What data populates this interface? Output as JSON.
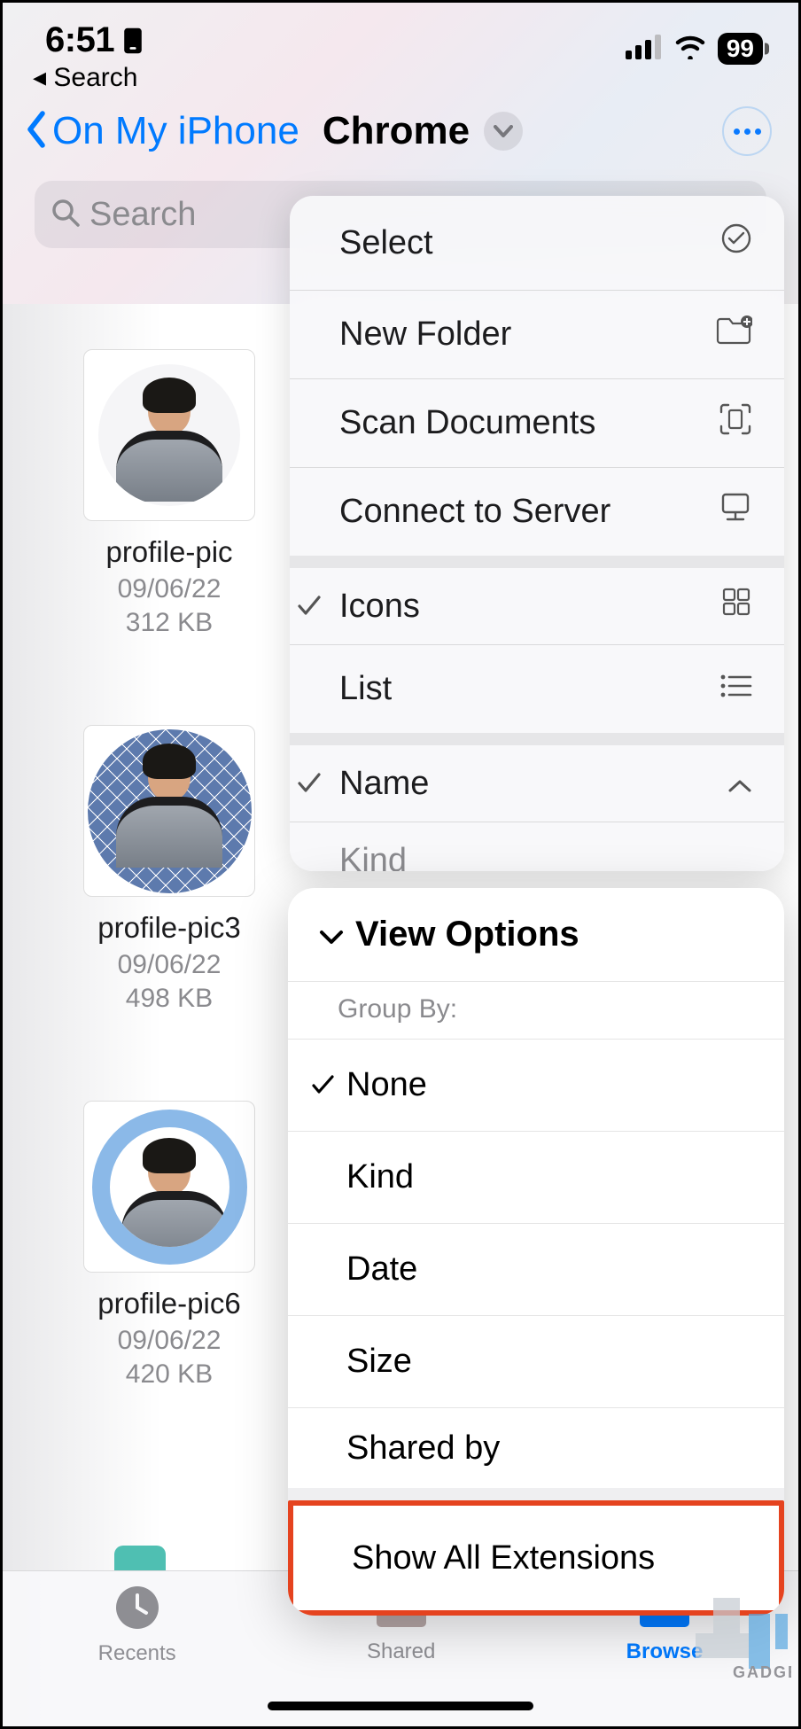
{
  "status": {
    "time": "6:51",
    "back_label": "◂ Search",
    "battery": "99"
  },
  "nav": {
    "back": "On My iPhone",
    "title": "Chrome"
  },
  "search": {
    "placeholder": "Search"
  },
  "files": [
    {
      "name": "profile-pic",
      "date": "09/06/22",
      "size": "312 KB"
    },
    {
      "name": "profile-pic3",
      "date": "09/06/22",
      "size": "498 KB"
    },
    {
      "name": "profile-pic6",
      "date": "09/06/22",
      "size": "420 KB"
    }
  ],
  "menu1": {
    "select": "Select",
    "new_folder": "New Folder",
    "scan_documents": "Scan Documents",
    "connect_server": "Connect to Server",
    "icons": "Icons",
    "list": "List",
    "name": "Name",
    "kind": "Kind"
  },
  "menu2": {
    "header": "View Options",
    "group_by": "Group By:",
    "none": "None",
    "kind": "Kind",
    "date": "Date",
    "size": "Size",
    "shared_by": "Shared by",
    "show_ext": "Show All Extensions"
  },
  "tabs": {
    "recents": "Recents",
    "shared": "Shared",
    "browse": "Browse"
  },
  "watermark": "GADGETS"
}
